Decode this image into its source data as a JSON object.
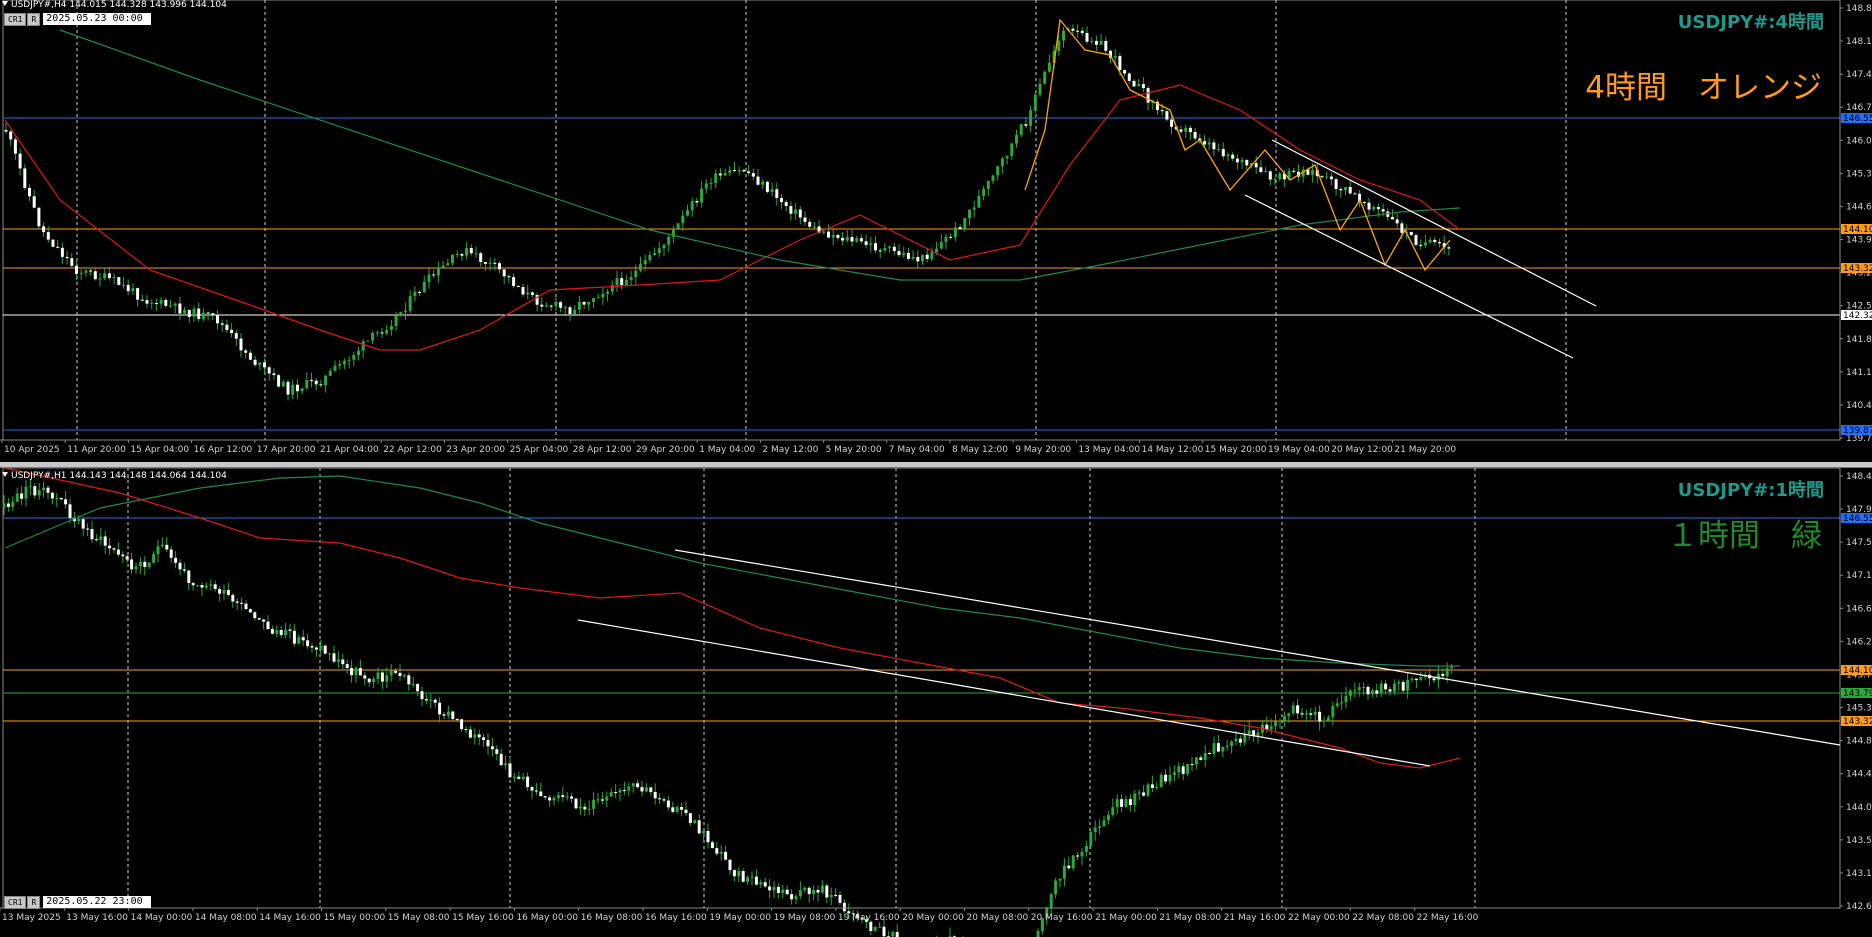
{
  "top": {
    "header": "USDJPY#,H4  144.015 144.328 143.996 144.104",
    "cr_label": "CR1",
    "r_label": "R",
    "date_box": "2025.05.23 00:00",
    "title": "USDJPY#:4時間",
    "subtitle": "4時間　オレンジ",
    "subtitle_color": "#ff9a1a",
    "y_ticks": [
      "148.86",
      "148.16",
      "147.46",
      "146.76",
      "146.04",
      "145.34",
      "144.64",
      "143.94",
      "143.22",
      "142.52",
      "141.82",
      "141.12",
      "140.42",
      "139.72"
    ],
    "x_labels": [
      "10 Apr 2025",
      "11 Apr 20:00",
      "15 Apr 04:00",
      "16 Apr 12:00",
      "17 Apr 20:00",
      "21 Apr 04:00",
      "22 Apr 12:00",
      "23 Apr 20:00",
      "25 Apr 04:00",
      "28 Apr 12:00",
      "29 Apr 20:00",
      "1 May 04:00",
      "2 May 12:00",
      "5 May 20:00",
      "7 May 04:00",
      "8 May 12:00",
      "9 May 20:00",
      "13 May 04:00",
      "14 May 12:00",
      "15 May 20:00",
      "19 May 04:00",
      "20 May 12:00",
      "21 May 20:00"
    ],
    "price_tags": [
      {
        "text": "146.55",
        "color": "#1e6fff"
      },
      {
        "text": "144.10",
        "color": "#ff9a1a"
      },
      {
        "text": "143.32",
        "color": "#ff9a1a"
      },
      {
        "text": "142.32",
        "color": "#ffffff"
      },
      {
        "text": "139.87",
        "color": "#1e6fff"
      }
    ]
  },
  "bottom": {
    "header": "USDJPY#,H1  144.143 144.148 144.064 144.104",
    "cr_label": "CR1",
    "r_label": "R",
    "date_box": "2025.05.22 23:00",
    "title": "USDJPY#:1時間",
    "subtitle": "１時間　緑",
    "subtitle_color": "#1e8a2a",
    "y_ticks": [
      "148.42",
      "147.98",
      "147.54",
      "147.10",
      "146.66",
      "146.21",
      "145.77",
      "145.33",
      "144.89",
      "144.45",
      "144.01",
      "143.56",
      "143.12",
      "142.68"
    ],
    "x_labels": [
      "13 May 2025",
      "13 May 16:00",
      "14 May 00:00",
      "14 May 08:00",
      "14 May 16:00",
      "15 May 00:00",
      "15 May 08:00",
      "15 May 16:00",
      "16 May 00:00",
      "16 May 08:00",
      "16 May 16:00",
      "19 May 00:00",
      "19 May 08:00",
      "19 May 16:00",
      "20 May 00:00",
      "20 May 08:00",
      "20 May 16:00",
      "21 May 00:00",
      "21 May 08:00",
      "21 May 16:00",
      "22 May 00:00",
      "22 May 08:00",
      "22 May 16:00"
    ],
    "price_tags": [
      {
        "text": "146.55",
        "color": "#1e6fff"
      },
      {
        "text": "144.10",
        "color": "#ff9a1a"
      },
      {
        "text": "143.79",
        "color": "#2ea83a"
      },
      {
        "text": "143.32",
        "color": "#ff9a1a"
      }
    ]
  }
}
